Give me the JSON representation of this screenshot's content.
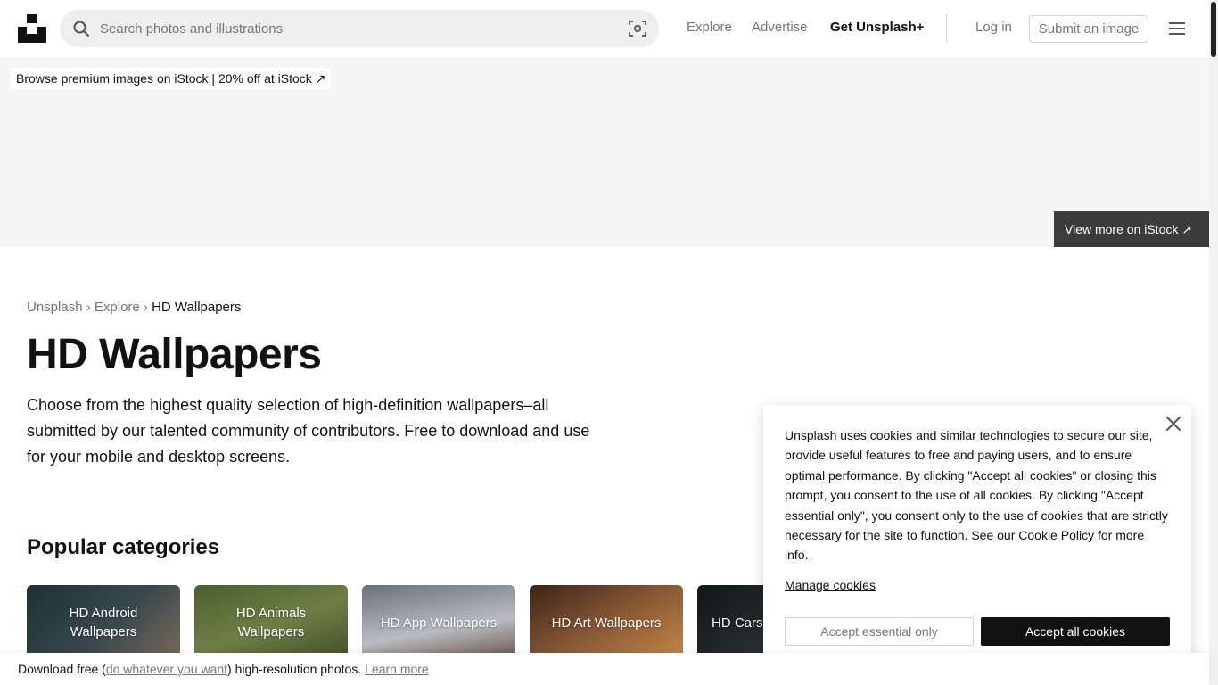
{
  "header": {
    "search_placeholder": "Search photos and illustrations",
    "nav": {
      "explore": "Explore",
      "advertise": "Advertise",
      "get_plus": "Get Unsplash+",
      "login": "Log in",
      "submit": "Submit an image"
    }
  },
  "banner": {
    "tag_strong": "Browse premium images on iStock",
    "tag_sep": " | ",
    "tag_offer": "20% off at iStock",
    "tag_arrow": "↗",
    "view_more": "View more on iStock",
    "view_more_arrow": "↗"
  },
  "breadcrumb": {
    "root": "Unsplash",
    "sep": "›",
    "explore": "Explore",
    "current": "HD Wallpapers"
  },
  "page": {
    "title": "HD Wallpapers",
    "description": "Choose from the highest quality selection of high-definition wallpapers–all submitted by our talented community of contributors. Free to download and use for your mobile and desktop screens.",
    "section_title": "Popular categories"
  },
  "categories": [
    {
      "label": "HD Android Wallpapers",
      "color": "#2b3a3f"
    },
    {
      "label": "HD Animals Wallpapers",
      "color": "#5a6e3a"
    },
    {
      "label": "HD App Wallpapers",
      "color": "#8a8e96"
    },
    {
      "label": "HD Art Wallpapers",
      "color": "#6b3d25"
    },
    {
      "label": "HD Cars",
      "color": "#1e2528"
    }
  ],
  "cookie": {
    "text_before": "Unsplash uses cookies and similar technologies to secure our site, provide useful features to free and paying users, and to ensure optimal performance. By clicking \"Accept all cookies\" or closing this prompt, you consent to the use of all cookies. By clicking \"Accept essential only\", you consent only to the use of cookies that are strictly necessary for the site to function. See our ",
    "policy_link": "Cookie Policy",
    "text_after": " for more info.",
    "manage": "Manage cookies",
    "essential": "Accept essential only",
    "accept_all": "Accept all cookies"
  },
  "bottom_bar": {
    "prefix": "Download free (",
    "link": "do whatever you want",
    "suffix": ") high-resolution photos. ",
    "learn_more": "Learn more"
  }
}
